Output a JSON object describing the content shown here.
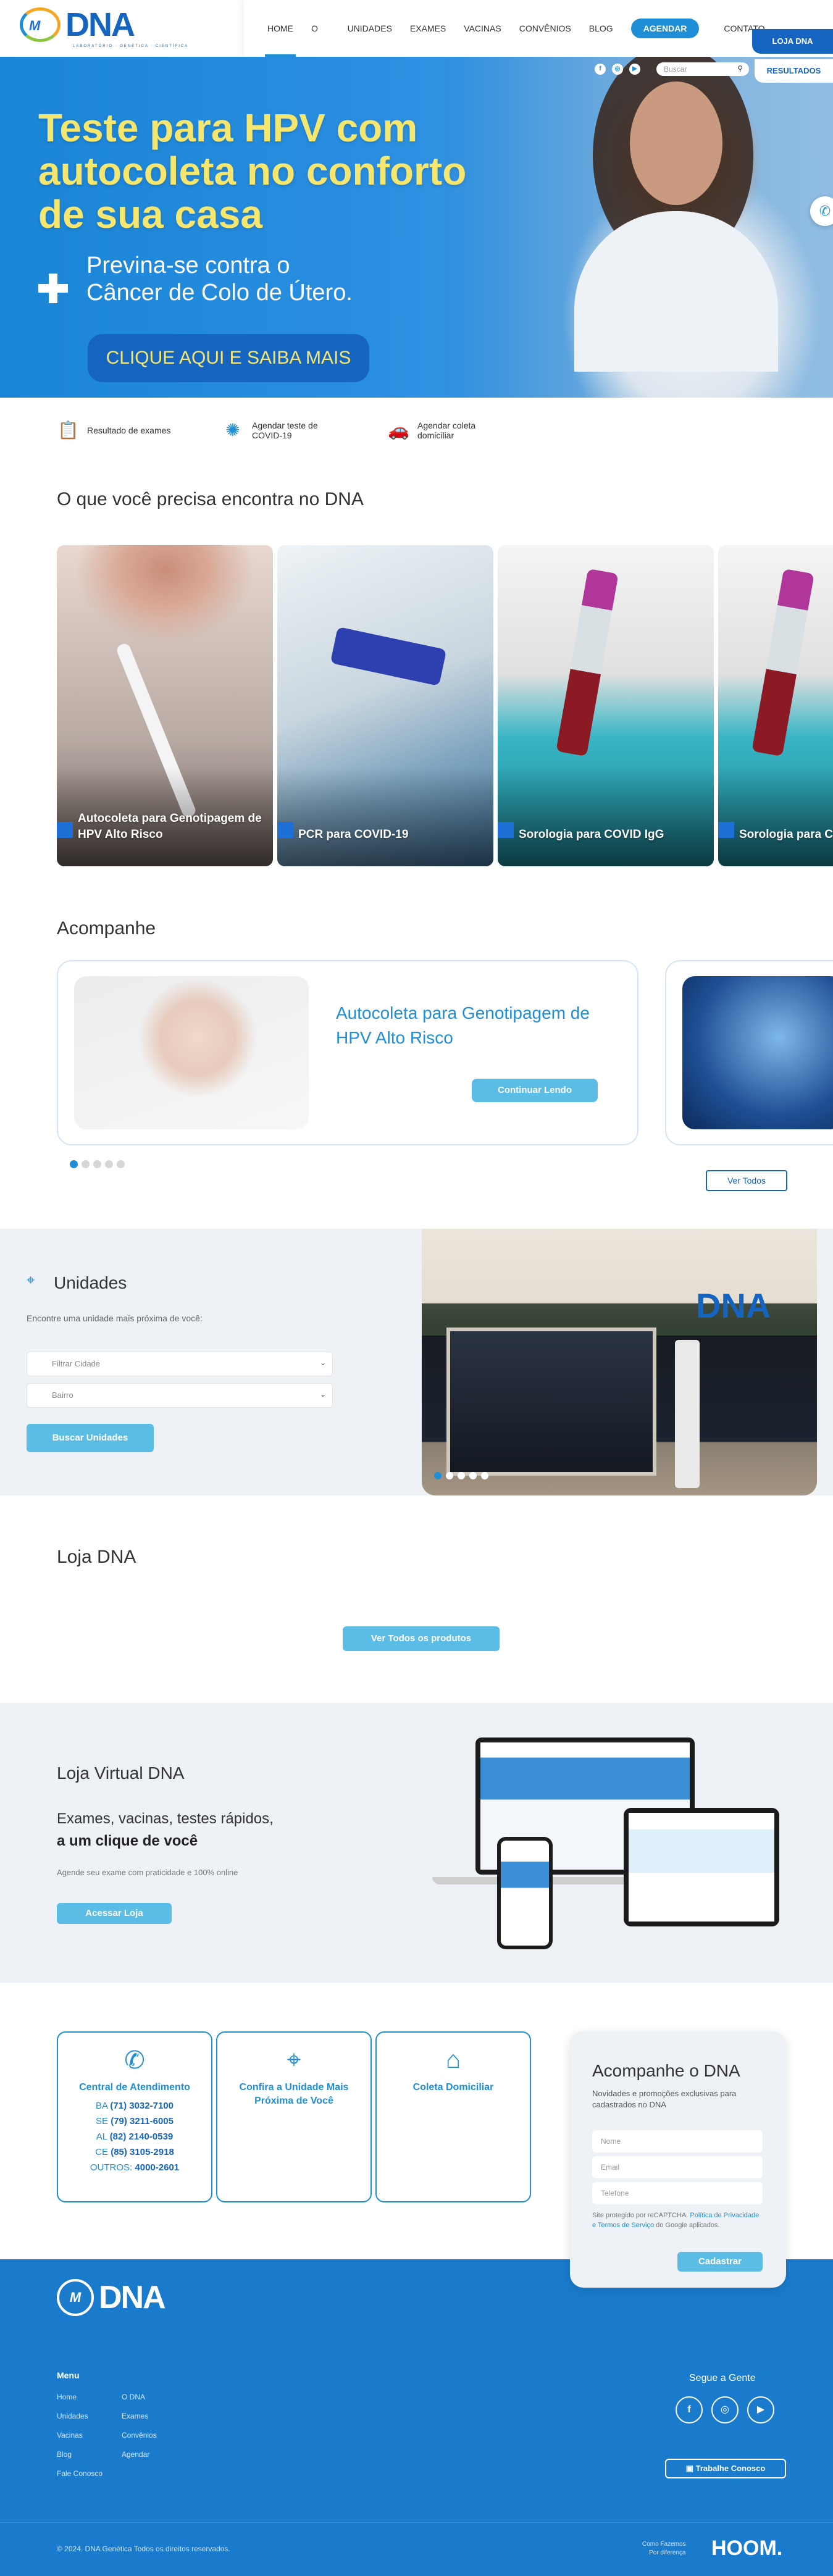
{
  "header": {
    "logo_text": "DNA",
    "logo_mark": "M",
    "logo_sub": "LABORATÓRIO · GENÉTICA · CIENTÍFICA",
    "nav": [
      "HOME",
      "O DNA",
      "UNIDADES",
      "EXAMES",
      "VACINAS",
      "CONVÊNIOS",
      "BLOG"
    ],
    "agendar": "AGENDAR",
    "contato": "CONTATO",
    "loja": "LOJA DNA",
    "resultados": "RESULTADOS",
    "search_placeholder": "Buscar"
  },
  "hero": {
    "title": "Teste para HPV com autocoleta no conforto de sua casa",
    "subtitle_line1": "Previna-se contra o",
    "subtitle_line2": "Câncer de Colo de Útero.",
    "cta": "CLIQUE AQUI E SAIBA MAIS",
    "social": [
      "f",
      "◎",
      "▶"
    ]
  },
  "quick_links": [
    {
      "icon": "clipboard-icon",
      "label": "Resultado de exames"
    },
    {
      "icon": "virus-icon",
      "label_1": "Agendar teste de",
      "label_2": "COVID-19"
    },
    {
      "icon": "car-icon",
      "label_1": "Agendar coleta",
      "label_2": "domiciliar"
    }
  ],
  "services": {
    "title": "O que você precisa encontra no DNA",
    "cards": [
      {
        "label": "Autocoleta para Genotipagem de HPV Alto Risco"
      },
      {
        "label": "PCR para COVID-19"
      },
      {
        "label": "Sorologia para COVID IgG"
      },
      {
        "label": "Sorologia para C"
      }
    ]
  },
  "acompanhe": {
    "title": "Acompanhe",
    "post_title": "Autocoleta para Genotipagem de HPV Alto Risco",
    "continue": "Continuar Lendo",
    "ver_todos": "Ver Todos"
  },
  "unidades": {
    "title": "Unidades",
    "desc": "Encontre uma unidade mais próxima de você:",
    "select_city": "Filtrar Cidade",
    "select_bairro": "Bairro",
    "button": "Buscar Unidades"
  },
  "loja": {
    "title": "Loja DNA",
    "button": "Ver Todos os produtos"
  },
  "loja_virtual": {
    "title": "Loja Virtual DNA",
    "headline_1": "Exames, vacinas, testes rápidos,",
    "headline_2": "a um clique de você",
    "desc": "Agende seu exame com praticidade e 100% online",
    "button": "Acessar Loja"
  },
  "contact": {
    "central_title": "Central de Atendimento",
    "phones": [
      {
        "state": "BA",
        "number": "(71) 3032-7100"
      },
      {
        "state": "SE",
        "number": "(79) 3211-6005"
      },
      {
        "state": "AL",
        "number": "(82) 2140-0539"
      },
      {
        "state": "CE",
        "number": "(85) 3105-2918"
      },
      {
        "state": "OUTROS:",
        "number": "4000-2601"
      }
    ],
    "confira_title": "Confira a Unidade Mais Próxima de Você",
    "coleta_title": "Coleta Domiciliar"
  },
  "newsletter": {
    "title": "Acompanhe o DNA",
    "desc": "Novidades e promoções exclusivas para cadastrados no DNA",
    "nome": "Nome",
    "email": "Email",
    "telefone": "Telefone",
    "recaptcha_1": "Site protegido por reCAPTCHA.",
    "recaptcha_link": "Política de Privacidade e Termos de Serviço",
    "recaptcha_2": "do Google aplicados.",
    "button": "Cadastrar"
  },
  "footer": {
    "menu_title": "Menu",
    "col1": [
      "Home",
      "Unidades",
      "Vacinas",
      "Blog",
      "Fale Conosco"
    ],
    "col2": [
      "O DNA",
      "Exames",
      "Convênios",
      "Agendar"
    ],
    "segue": "Segue a Gente",
    "trabalhe": "Trabalhe Conosco",
    "copyright": "© 2024. DNA Genética Todos os direitos reservados.",
    "credit_1": "Como Fazemos",
    "credit_2": "Por diferença",
    "agency": "HOOM."
  },
  "colors": {
    "primary": "#1e8fd6",
    "dark": "#1565c0",
    "accent": "#f4e66e",
    "light": "#5bbde6"
  }
}
